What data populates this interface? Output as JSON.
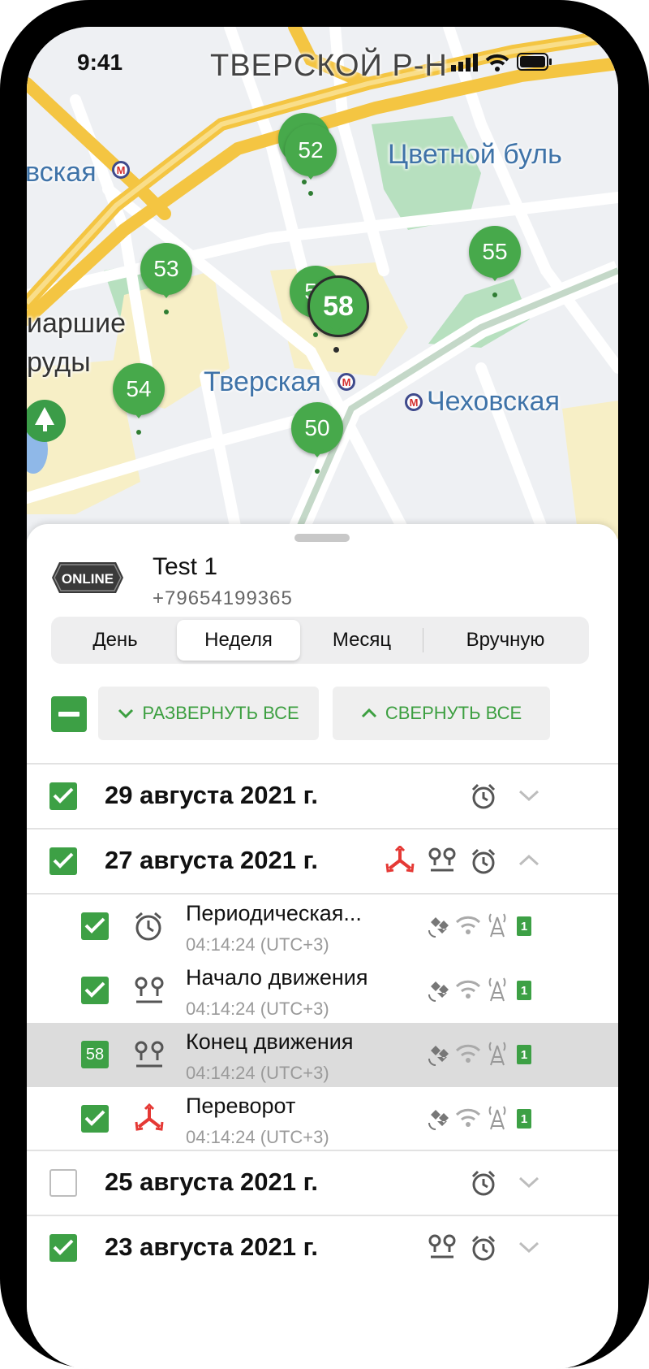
{
  "status_bar": {
    "time": "9:41"
  },
  "map": {
    "district_label": "ТВЕРСКОЙ Р-Н",
    "labels": [
      "Цветной буль",
      "вская",
      "иаршие",
      "руды",
      "Тверская",
      "Чеховская"
    ],
    "markers": [
      "52",
      "53",
      "55",
      "5",
      "58",
      "54",
      "50"
    ],
    "selected_marker": "58"
  },
  "device": {
    "status": "ONLINE",
    "name": "Test 1",
    "phone": "+79654199365"
  },
  "period_tabs": [
    "День",
    "Неделя",
    "Месяц",
    "Вручную"
  ],
  "period_selected": "Неделя",
  "actions": {
    "expand_all": "РАЗВЕРНУТЬ ВСЕ",
    "collapse_all": "СВЕРНУТЬ ВСЕ"
  },
  "groups": [
    {
      "date": "29 августа 2021 г.",
      "checked": true,
      "icons": [
        "alarm-clock-icon"
      ],
      "expanded": false
    },
    {
      "date": "27 августа 2021 г.",
      "checked": true,
      "icons": [
        "rollover-icon",
        "movement-icon",
        "alarm-clock-icon"
      ],
      "expanded": true,
      "events": [
        {
          "title": "Периодическая...",
          "time": "04:14:24 (UTC+3)",
          "icon": "alarm-clock-icon",
          "checked": true,
          "sim": "1"
        },
        {
          "title": "Начало движения",
          "time": "04:14:24 (UTC+3)",
          "icon": "movement-icon",
          "checked": true,
          "sim": "1"
        },
        {
          "title": "Конец движения",
          "time": "04:14:24 (UTC+3)",
          "icon": "movement-icon",
          "checked": true,
          "badge": "58",
          "selected": true,
          "sim": "1"
        },
        {
          "title": "Переворот",
          "time": "04:14:24 (UTC+3)",
          "icon": "rollover-icon",
          "checked": true,
          "sim": "1"
        }
      ]
    },
    {
      "date": "25 августа 2021 г.",
      "checked": false,
      "icons": [
        "alarm-clock-icon"
      ],
      "expanded": false
    },
    {
      "date": "23 августа 2021 г.",
      "checked": true,
      "icons": [
        "movement-icon",
        "alarm-clock-icon"
      ],
      "expanded": false
    }
  ],
  "colors": {
    "accent": "#3da045",
    "marker": "#47a94b",
    "alert": "#e53935",
    "selected_row": "#dcdcdc"
  }
}
